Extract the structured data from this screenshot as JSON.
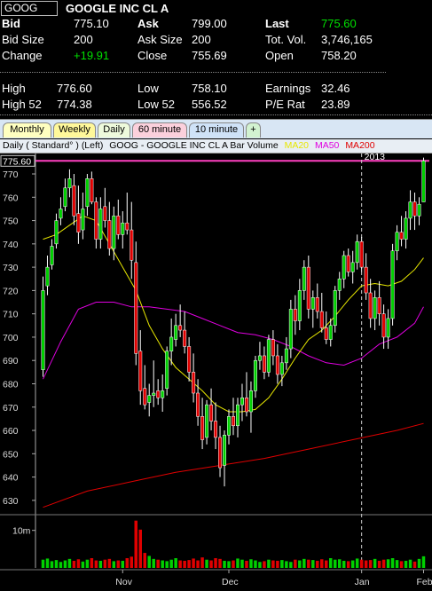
{
  "quote": {
    "symbol": "GOOG",
    "company": "GOOGLE INC CL A",
    "bid_label": "Bid",
    "bid": "775.10",
    "ask_label": "Ask",
    "ask": "799.00",
    "last_label": "Last",
    "last": "775.60",
    "bidsize_label": "Bid Size",
    "bidsize": "200",
    "asksize_label": "Ask Size",
    "asksize": "200",
    "totvol_label": "Tot. Vol.",
    "totvol": "3,746,165",
    "change_label": "Change",
    "change": "+19.91",
    "close_label": "Close",
    "close": "755.69",
    "open_label": "Open",
    "open": "758.20",
    "high_label": "High",
    "high": "776.60",
    "low_label": "Low",
    "low": "758.10",
    "earnings_label": "Earnings",
    "earnings": "32.46",
    "high52_label": "High 52",
    "high52": "774.38",
    "low52_label": "Low 52",
    "low52": "556.52",
    "pe_label": "P/E Rat",
    "pe": "23.89"
  },
  "tabs": [
    {
      "label": "Monthly",
      "color": "#ffffc0"
    },
    {
      "label": "Weekly",
      "color": "#fff89a"
    },
    {
      "label": "Daily",
      "color": "#eefadc"
    },
    {
      "label": "60 minute",
      "color": "#fbd0dc"
    },
    {
      "label": "10 minute",
      "color": "#cfe2f7"
    },
    {
      "label": "+",
      "color": "#d2f2d0"
    }
  ],
  "chart_header": {
    "label": "Daily ( Standard° )  (Left)",
    "title": "GOOG - GOOGLE INC CL A  Bar  Volume",
    "ma20": "MA20",
    "ma50": "MA50",
    "ma200": "MA200",
    "ma20_color": "#e8e800",
    "ma50_color": "#e000e0",
    "ma200_color": "#e00000"
  },
  "chart_data": {
    "type": "candlestick",
    "price_axis": {
      "ticks": [
        630,
        640,
        650,
        660,
        670,
        680,
        690,
        700,
        710,
        720,
        730,
        740,
        750,
        760,
        770
      ],
      "ylim": [
        625,
        778
      ]
    },
    "current_price_marker": "775.60",
    "year_label": "2013",
    "month_labels": [
      "Nov",
      "Dec",
      "Jan",
      "Feb"
    ],
    "volume_axis": {
      "tick_label": "10m",
      "ylim": [
        0,
        13
      ]
    },
    "colors": {
      "up": "#00d000",
      "down": "#e00000",
      "ma20": "#e8e800",
      "ma50": "#e000e0",
      "ma200": "#e00000",
      "marker": "#ff40c0"
    },
    "candles": [
      [
        686,
        726,
        683,
        720
      ],
      [
        722,
        735,
        718,
        730
      ],
      [
        731,
        742,
        729,
        739
      ],
      [
        740,
        753,
        738,
        750
      ],
      [
        751,
        760,
        748,
        755
      ],
      [
        756,
        768,
        754,
        764
      ],
      [
        764,
        772,
        760,
        768
      ],
      [
        765,
        770,
        748,
        752
      ],
      [
        753,
        765,
        740,
        745
      ],
      [
        746,
        762,
        742,
        755
      ],
      [
        756,
        770,
        752,
        768
      ],
      [
        768,
        771,
        757,
        758
      ],
      [
        758,
        760,
        738,
        742
      ],
      [
        742,
        760,
        738,
        755
      ],
      [
        756,
        764,
        747,
        750
      ],
      [
        750,
        758,
        735,
        738
      ],
      [
        738,
        756,
        733,
        752
      ],
      [
        752,
        759,
        742,
        744
      ],
      [
        744,
        754,
        738,
        749
      ],
      [
        749,
        762,
        744,
        746
      ],
      [
        746,
        758,
        725,
        733
      ],
      [
        732,
        741,
        688,
        693
      ],
      [
        694,
        703,
        671,
        677
      ],
      [
        678,
        688,
        669,
        671
      ],
      [
        672,
        680,
        666,
        675
      ],
      [
        675,
        690,
        670,
        676
      ],
      [
        677,
        682,
        671,
        674
      ],
      [
        674,
        684,
        668,
        677
      ],
      [
        678,
        696,
        675,
        694
      ],
      [
        694,
        708,
        688,
        700
      ],
      [
        699,
        710,
        696,
        705
      ],
      [
        705,
        714,
        700,
        703
      ],
      [
        703,
        711,
        693,
        696
      ],
      [
        696,
        700,
        681,
        685
      ],
      [
        685,
        693,
        672,
        676
      ],
      [
        676,
        682,
        662,
        666
      ],
      [
        666,
        674,
        652,
        656
      ],
      [
        657,
        673,
        654,
        671
      ],
      [
        671,
        678,
        660,
        664
      ],
      [
        664,
        672,
        652,
        657
      ],
      [
        657,
        662,
        640,
        644
      ],
      [
        645,
        660,
        636,
        658
      ],
      [
        658,
        669,
        654,
        666
      ],
      [
        666,
        674,
        658,
        662
      ],
      [
        662,
        674,
        657,
        671
      ],
      [
        671,
        680,
        664,
        674
      ],
      [
        674,
        685,
        666,
        668
      ],
      [
        668,
        681,
        659,
        677
      ],
      [
        677,
        692,
        674,
        690
      ],
      [
        690,
        698,
        686,
        692
      ],
      [
        692,
        696,
        682,
        685
      ],
      [
        685,
        701,
        683,
        699
      ],
      [
        699,
        703,
        688,
        692
      ],
      [
        692,
        697,
        680,
        684
      ],
      [
        684,
        692,
        679,
        689
      ],
      [
        689,
        700,
        686,
        695
      ],
      [
        695,
        716,
        691,
        712
      ],
      [
        712,
        718,
        701,
        707
      ],
      [
        707,
        725,
        703,
        720
      ],
      [
        720,
        733,
        716,
        730
      ],
      [
        730,
        735,
        708,
        712
      ],
      [
        712,
        720,
        704,
        717
      ],
      [
        717,
        723,
        708,
        711
      ],
      [
        711,
        719,
        702,
        704
      ],
      [
        704,
        711,
        697,
        699
      ],
      [
        699,
        708,
        696,
        705
      ],
      [
        705,
        722,
        702,
        720
      ],
      [
        720,
        728,
        716,
        725
      ],
      [
        725,
        737,
        721,
        735
      ],
      [
        735,
        738,
        726,
        728
      ],
      [
        728,
        737,
        723,
        732
      ],
      [
        732,
        744,
        729,
        741
      ],
      [
        741,
        743,
        728,
        730
      ],
      [
        730,
        736,
        716,
        719
      ],
      [
        719,
        725,
        704,
        708
      ],
      [
        708,
        720,
        703,
        717
      ],
      [
        717,
        724,
        705,
        710
      ],
      [
        710,
        714,
        695,
        700
      ],
      [
        700,
        712,
        695,
        708
      ],
      [
        708,
        740,
        705,
        737
      ],
      [
        737,
        748,
        733,
        745
      ],
      [
        745,
        752,
        739,
        742
      ],
      [
        742,
        754,
        738,
        751
      ],
      [
        751,
        763,
        746,
        758
      ],
      [
        758,
        762,
        746,
        752
      ],
      [
        752,
        760,
        748,
        757
      ],
      [
        758,
        777,
        758,
        775.6
      ]
    ],
    "ma20": [
      [
        0,
        742
      ],
      [
        3,
        744
      ],
      [
        6,
        748
      ],
      [
        9,
        752
      ],
      [
        12,
        750
      ],
      [
        15,
        740
      ],
      [
        18,
        730
      ],
      [
        21,
        720
      ],
      [
        24,
        705
      ],
      [
        27,
        695
      ],
      [
        30,
        687
      ],
      [
        33,
        682
      ],
      [
        36,
        677
      ],
      [
        39,
        671
      ],
      [
        42,
        668
      ],
      [
        45,
        668
      ],
      [
        48,
        669
      ],
      [
        51,
        674
      ],
      [
        54,
        682
      ],
      [
        57,
        691
      ],
      [
        60,
        699
      ],
      [
        63,
        703
      ],
      [
        66,
        709
      ],
      [
        69,
        716
      ],
      [
        72,
        722
      ],
      [
        75,
        723
      ],
      [
        78,
        722
      ],
      [
        81,
        724
      ],
      [
        84,
        729
      ],
      [
        86,
        734
      ]
    ],
    "ma50": [
      [
        0,
        682
      ],
      [
        4,
        698
      ],
      [
        8,
        712
      ],
      [
        12,
        715
      ],
      [
        16,
        715
      ],
      [
        20,
        713
      ],
      [
        24,
        713
      ],
      [
        28,
        712
      ],
      [
        32,
        711
      ],
      [
        36,
        708
      ],
      [
        40,
        705
      ],
      [
        44,
        702
      ],
      [
        48,
        701
      ],
      [
        52,
        699
      ],
      [
        56,
        696
      ],
      [
        60,
        692
      ],
      [
        64,
        689
      ],
      [
        68,
        688
      ],
      [
        72,
        691
      ],
      [
        76,
        697
      ],
      [
        80,
        700
      ],
      [
        84,
        706
      ],
      [
        86,
        713
      ]
    ],
    "ma200": [
      [
        0,
        627
      ],
      [
        10,
        634
      ],
      [
        20,
        638
      ],
      [
        30,
        642
      ],
      [
        40,
        645
      ],
      [
        50,
        648
      ],
      [
        60,
        652
      ],
      [
        70,
        656
      ],
      [
        80,
        660
      ],
      [
        86,
        663
      ]
    ],
    "volumes": [
      2.2,
      2.5,
      1.8,
      2.1,
      1.6,
      2.0,
      2.4,
      1.9,
      2.3,
      1.7,
      2.2,
      2.6,
      2.0,
      1.9,
      2.2,
      2.4,
      1.8,
      2.0,
      1.9,
      2.6,
      3.0,
      12.6,
      10.2,
      4.0,
      3.2,
      2.4,
      2.2,
      2.0,
      1.8,
      2.2,
      2.6,
      2.0,
      1.9,
      2.1,
      2.5,
      2.0,
      2.8,
      2.2,
      2.0,
      2.6,
      2.4,
      1.9,
      1.8,
      2.0,
      2.5,
      2.2,
      1.9,
      2.3,
      2.0,
      1.6,
      1.8,
      2.2,
      2.0,
      1.9,
      2.1,
      1.8,
      1.6,
      2.2,
      2.0,
      2.4,
      2.2,
      2.1,
      1.9,
      2.3,
      2.0,
      2.6,
      2.2,
      2.3,
      1.9,
      1.8,
      2.0,
      2.5,
      2.2,
      2.0,
      2.1,
      2.4,
      1.9,
      2.2,
      2.3,
      2.6,
      2.1,
      1.8,
      1.9,
      2.2,
      1.7,
      2.4,
      3.1
    ]
  }
}
